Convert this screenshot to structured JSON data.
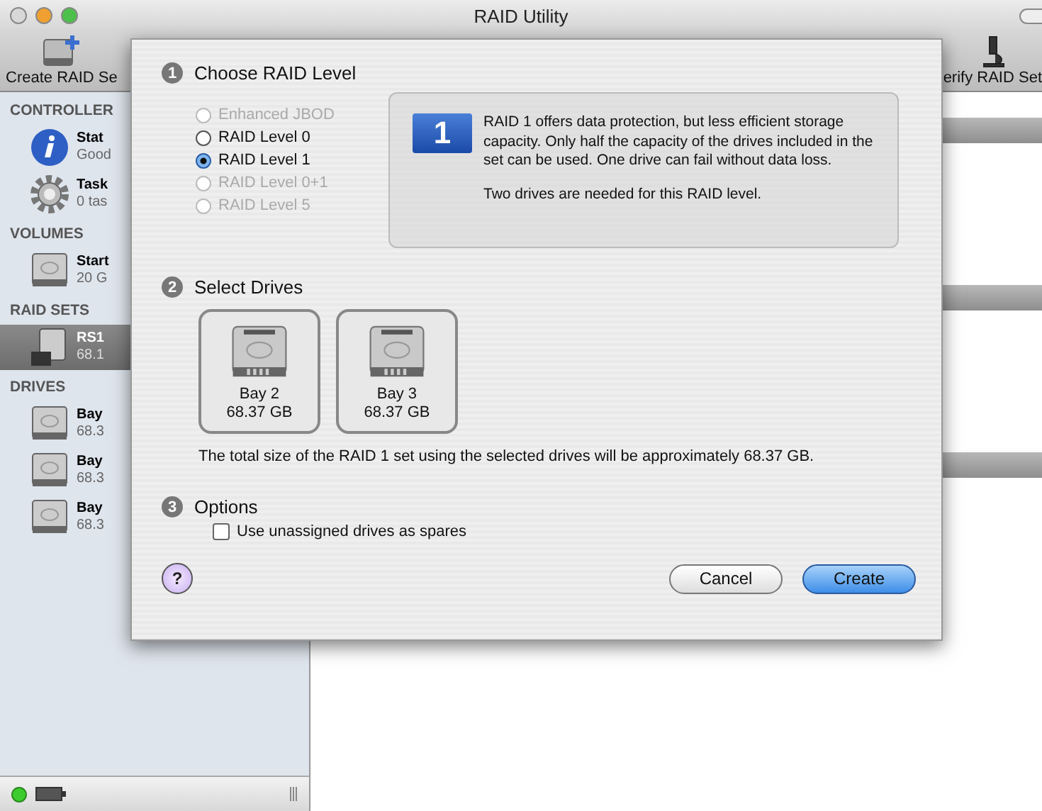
{
  "window": {
    "title": "RAID Utility"
  },
  "toolbar": {
    "items": [
      {
        "kind": "create",
        "label": "Create RAID Se"
      },
      {
        "kind": "verify",
        "label": "erify RAID Set"
      }
    ]
  },
  "sidebar": {
    "sections": [
      {
        "heading": "CONTROLLER",
        "items": [
          {
            "kind": "info",
            "name": "Stat",
            "detail": "Good",
            "selected": false
          },
          {
            "kind": "gear",
            "name": "Task",
            "detail": "0 tas",
            "selected": false
          }
        ]
      },
      {
        "heading": "VOLUMES",
        "items": [
          {
            "kind": "drive",
            "name": "Start",
            "detail": "20 G",
            "selected": false
          }
        ]
      },
      {
        "heading": "RAID SETS",
        "items": [
          {
            "kind": "raid",
            "name": "RS1",
            "detail": "68.1",
            "selected": true
          }
        ]
      },
      {
        "heading": "DRIVES",
        "items": [
          {
            "kind": "drive",
            "name": "Bay",
            "detail": "68.3",
            "selected": false
          },
          {
            "kind": "drive",
            "name": "Bay",
            "detail": "68.3",
            "selected": false
          },
          {
            "kind": "drive",
            "name": "Bay",
            "detail": "68.3",
            "selected": false
          }
        ]
      }
    ]
  },
  "sheet": {
    "level_step": {
      "number": "1",
      "title": "Choose RAID Level",
      "options": [
        {
          "label": "Enhanced JBOD",
          "disabled": true,
          "selected": false
        },
        {
          "label": "RAID Level 0",
          "disabled": false,
          "selected": false
        },
        {
          "label": "RAID Level 1",
          "disabled": false,
          "selected": true
        },
        {
          "label": "RAID Level 0+1",
          "disabled": true,
          "selected": false
        },
        {
          "label": "RAID Level 5",
          "disabled": true,
          "selected": false
        }
      ],
      "badge": "1",
      "description": "RAID 1 offers data protection, but less efficient storage capacity. Only half the capacity of the drives included in the set can be used. One drive can fail without data loss.",
      "note": "Two drives are needed for this RAID level."
    },
    "drives_step": {
      "number": "2",
      "title": "Select Drives",
      "drives": [
        {
          "name": "Bay 2",
          "size": "68.37 GB"
        },
        {
          "name": "Bay 3",
          "size": "68.37 GB"
        }
      ],
      "summary": "The total size of the RAID 1 set using the selected drives will be approximately 68.37 GB."
    },
    "options_step": {
      "number": "3",
      "title": "Options",
      "spares": {
        "label": "Use unassigned drives as spares",
        "checked": false
      }
    },
    "help": "?",
    "buttons": [
      {
        "label": "Cancel",
        "default": false
      },
      {
        "label": "Create",
        "default": true
      }
    ]
  }
}
